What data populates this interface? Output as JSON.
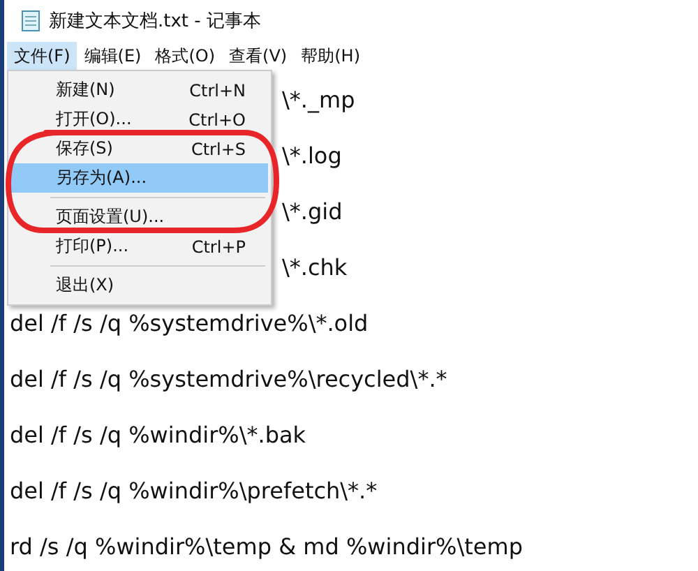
{
  "window": {
    "title": "新建文本文档.txt - 记事本"
  },
  "menu_bar": [
    {
      "label": "文件(F)",
      "selected": true
    },
    {
      "label": "编辑(E)",
      "selected": false
    },
    {
      "label": "格式(O)",
      "selected": false
    },
    {
      "label": "查看(V)",
      "selected": false
    },
    {
      "label": "帮助(H)",
      "selected": false
    }
  ],
  "file_menu": [
    {
      "kind": "item",
      "label": "新建(N)",
      "shortcut": "Ctrl+N",
      "selected": false
    },
    {
      "kind": "item",
      "label": "打开(O)...",
      "shortcut": "Ctrl+O",
      "selected": false
    },
    {
      "kind": "item",
      "label": "保存(S)",
      "shortcut": "Ctrl+S",
      "selected": false
    },
    {
      "kind": "item",
      "label": "另存为(A)...",
      "selected": true
    },
    {
      "kind": "separator"
    },
    {
      "kind": "item",
      "label": "页面设置(U)...",
      "selected": false
    },
    {
      "kind": "item",
      "label": "打印(P)...",
      "shortcut": "Ctrl+P",
      "selected": false
    },
    {
      "kind": "separator"
    },
    {
      "kind": "item",
      "label": "退出(X)",
      "selected": false
    }
  ],
  "editor_lines_behind_menu": [
    "\\*._mp",
    "\\*.log",
    "\\*.gid",
    "\\*.chk"
  ],
  "editor_lines": [
    "del /f /s /q %systemdrive%\\*.old",
    "del /f /s /q %systemdrive%\\recycled\\*.*",
    "del /f /s /q %windir%\\*.bak",
    "del /f /s /q %windir%\\prefetch\\*.*",
    "rd /s /q %windir%\\temp & md %windir%\\temp"
  ]
}
